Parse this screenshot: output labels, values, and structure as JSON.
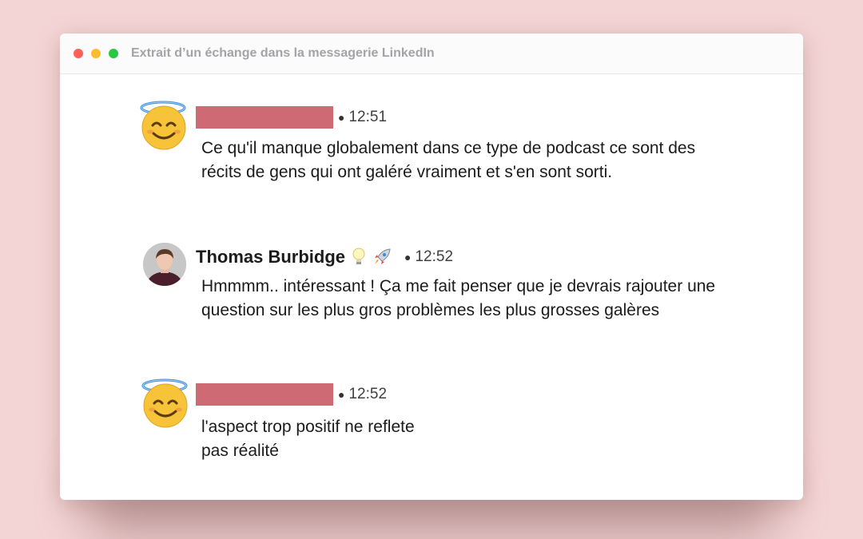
{
  "window": {
    "title": "Extrait d’un échange dans la messagerie LinkedIn"
  },
  "messages": [
    {
      "sender": "",
      "time": "12:51",
      "lines": [
        "Ce qu'il manque globalement dans ce type de podcast ce sont des récits de gens qui ont galéré vraiment et s'en sont sorti."
      ]
    },
    {
      "sender": "Thomas Burbidge",
      "time": "12:52",
      "lines": [
        "Hmmmm.. intéressant ! Ça me fait penser que je devrais rajouter une question sur les plus gros problèmes les plus grosses galères"
      ]
    },
    {
      "sender": "",
      "time": "12:52",
      "lines": [
        "l'aspect trop positif ne reflete",
        "pas réalité"
      ]
    }
  ],
  "colors": {
    "background": "#f4d5d5",
    "redaction": "#cd6a74",
    "close": "#fe5f57",
    "minimize": "#febc2e",
    "maximize": "#28c840"
  },
  "icons": {
    "redacted_avatar": "smiling-face-with-halo-icon",
    "name_badges": [
      "light-bulb-icon",
      "rocket-icon"
    ]
  }
}
